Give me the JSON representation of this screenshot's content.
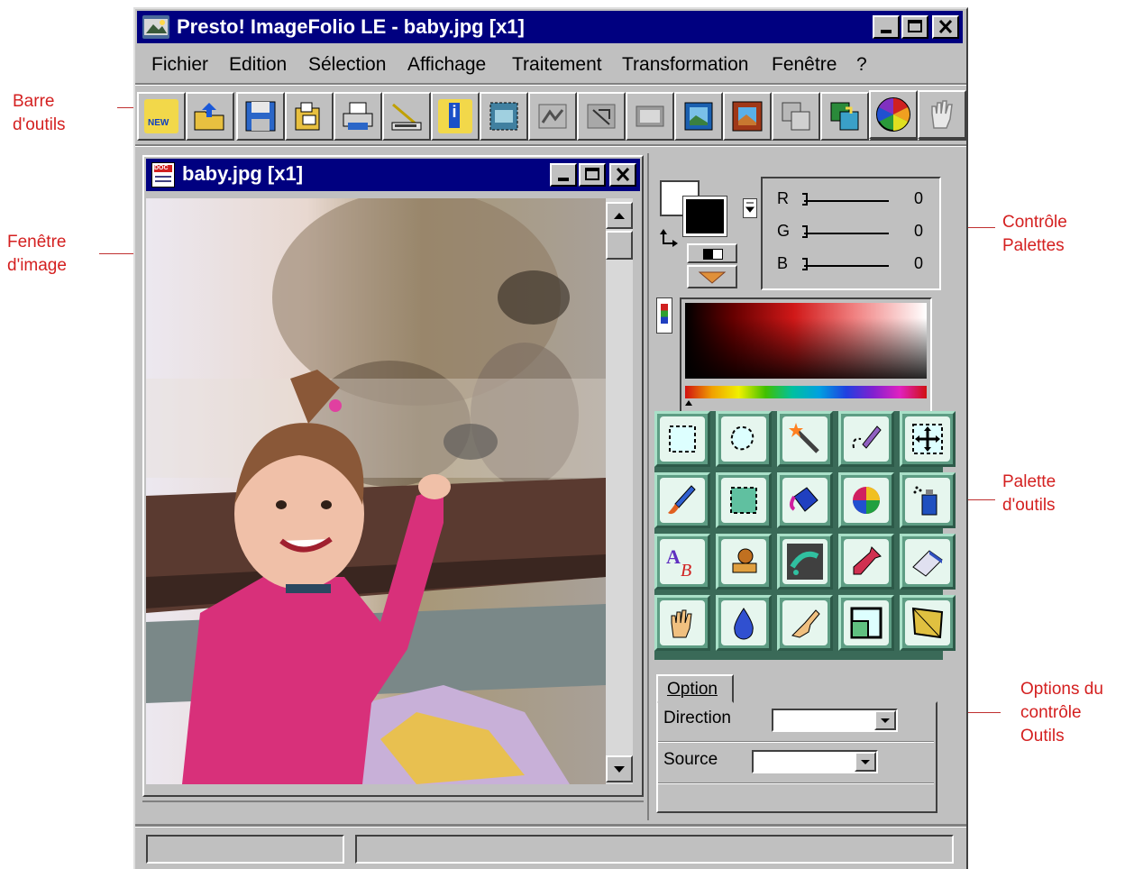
{
  "annotations": {
    "toolbar": [
      "Barre",
      "d'outils"
    ],
    "image_window": [
      "Fenêtre",
      "d'image"
    ],
    "palette_control": [
      "Contrôle",
      "Palettes"
    ],
    "tool_palette": [
      "Palette",
      "d'outils"
    ],
    "tool_options": [
      "Options du",
      "contrôle",
      "Outils"
    ]
  },
  "app": {
    "title": "Presto! ImageFolio LE - baby.jpg [x1]",
    "menu": [
      "Fichier",
      "Edition",
      "Sélection",
      "Affichage",
      "Traitement",
      "Transformation",
      "Fenêtre",
      "?"
    ]
  },
  "toolbar": {
    "buttons": [
      "new-icon",
      "open-icon",
      "save-icon",
      "browse-icon",
      "print-icon",
      "scan-icon",
      "info-icon",
      "crop-icon",
      "image-icon",
      "grayscale-icon",
      "resize-icon",
      "film-icon",
      "frame-icon",
      "copy-icon",
      "paste-icon",
      "measure-icon",
      "faucet-icon",
      "color-wheel-icon",
      "hand-icon"
    ]
  },
  "document": {
    "title": "baby.jpg [x1]"
  },
  "color_control": {
    "channels": [
      {
        "label": "R",
        "value": "0"
      },
      {
        "label": "G",
        "value": "0"
      },
      {
        "label": "B",
        "value": "0"
      }
    ],
    "foreground": "#000000",
    "background": "#ffffff"
  },
  "tools": [
    [
      "rect-select-icon",
      "lasso-icon",
      "magic-wand-icon",
      "paint-select-icon",
      "move-icon"
    ],
    [
      "brush-icon",
      "fill-rect-icon",
      "paint-bucket-icon",
      "color-ball-icon",
      "spray-icon"
    ],
    [
      "text-icon",
      "stamp-icon",
      "smudge-icon",
      "eyedropper-icon",
      "eraser-icon"
    ],
    [
      "hand-icon",
      "drop-icon",
      "finger-icon",
      "crop-tool-icon",
      "distort-icon"
    ]
  ],
  "options": {
    "tab": "Option",
    "direction_label": "Direction",
    "source_label": "Source"
  },
  "colors": {
    "titlebar": "#000080",
    "face": "#c0c0c0",
    "tool_green": "#5e9d84",
    "callout": "#d42020"
  }
}
